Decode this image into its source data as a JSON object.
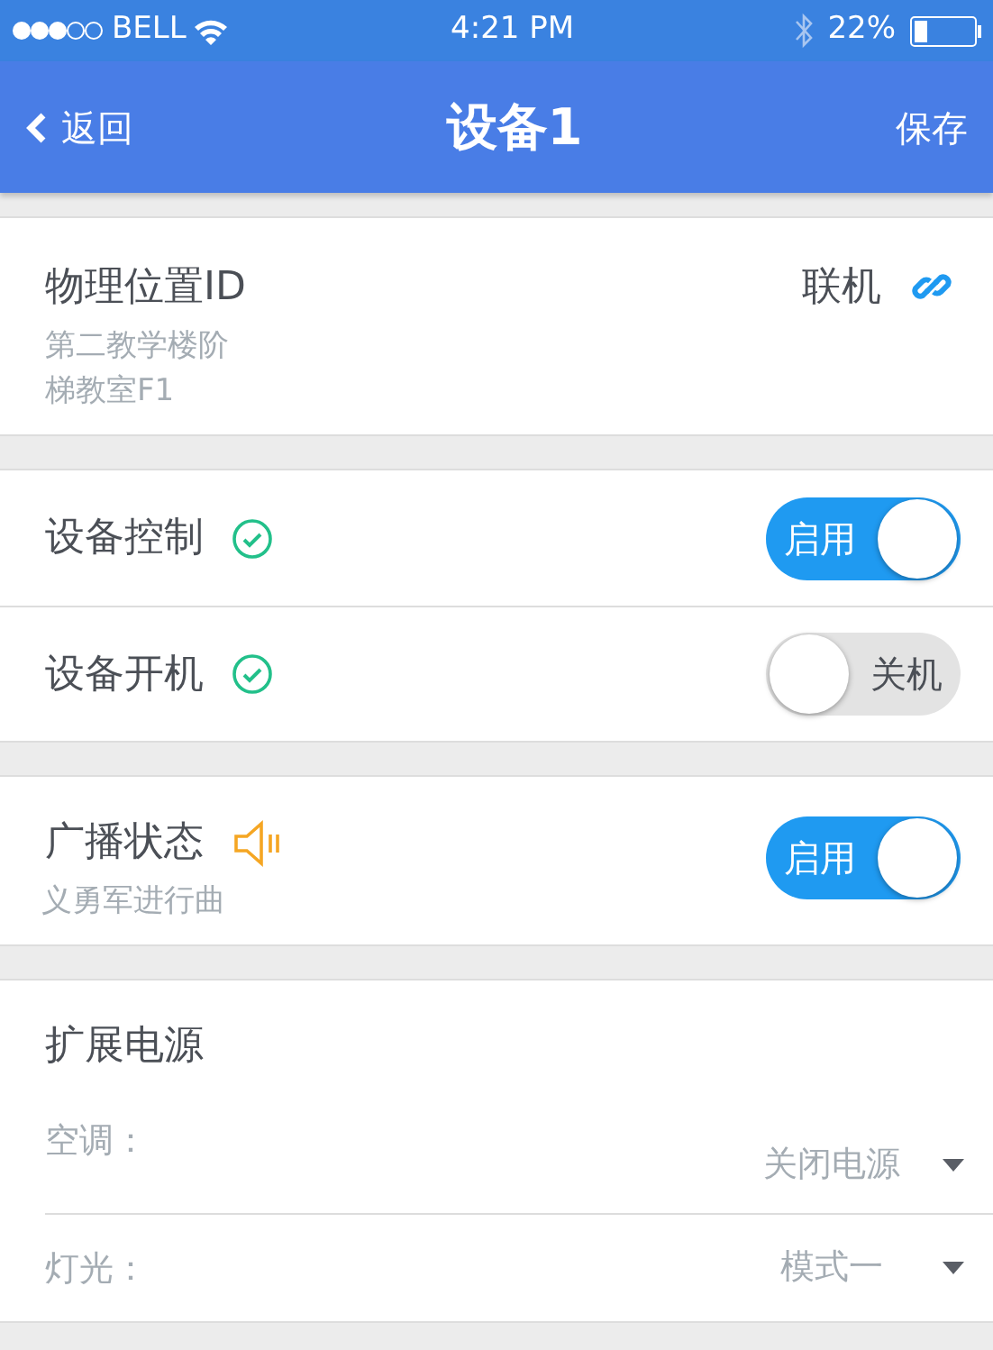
{
  "status_bar": {
    "carrier": "BELL",
    "time": "4:21 PM",
    "battery": "22%"
  },
  "nav": {
    "back": "返回",
    "title": "设备1",
    "action": "保存"
  },
  "location": {
    "label": "物理位置ID",
    "value": "第二教学楼阶梯教室F1",
    "status": "联机"
  },
  "controls": [
    {
      "label": "设备控制",
      "switch": {
        "on": true,
        "label": "启用"
      }
    },
    {
      "label": "设备开机",
      "switch": {
        "on": false,
        "label": "关机"
      }
    }
  ],
  "broadcast": {
    "label": "广播状态",
    "subtitle": "义勇军进行曲",
    "switch": {
      "on": true,
      "label": "启用"
    }
  },
  "power": {
    "title": "扩展电源",
    "selects": [
      {
        "label": "空调：",
        "value": "关闭电源"
      },
      {
        "label": "灯光：",
        "value": "模式一"
      }
    ]
  }
}
